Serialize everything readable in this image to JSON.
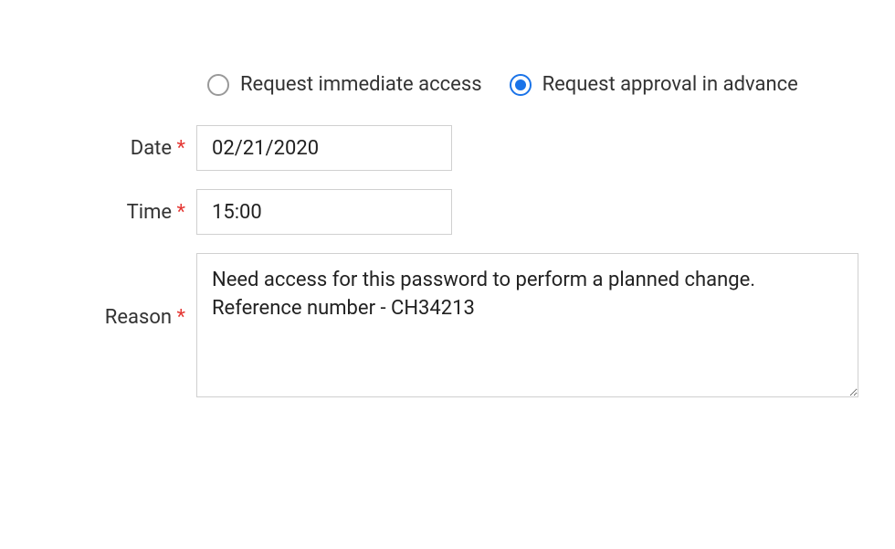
{
  "radios": {
    "immediate": {
      "label": "Request immediate access",
      "selected": false
    },
    "advance": {
      "label": "Request approval in advance",
      "selected": true
    }
  },
  "fields": {
    "date": {
      "label": "Date",
      "value": "02/21/2020"
    },
    "time": {
      "label": "Time",
      "value": "15:00"
    },
    "reason": {
      "label": "Reason",
      "value": "Need access for this password to perform a planned change. Reference number - CH34213"
    }
  },
  "required_marker": "*"
}
